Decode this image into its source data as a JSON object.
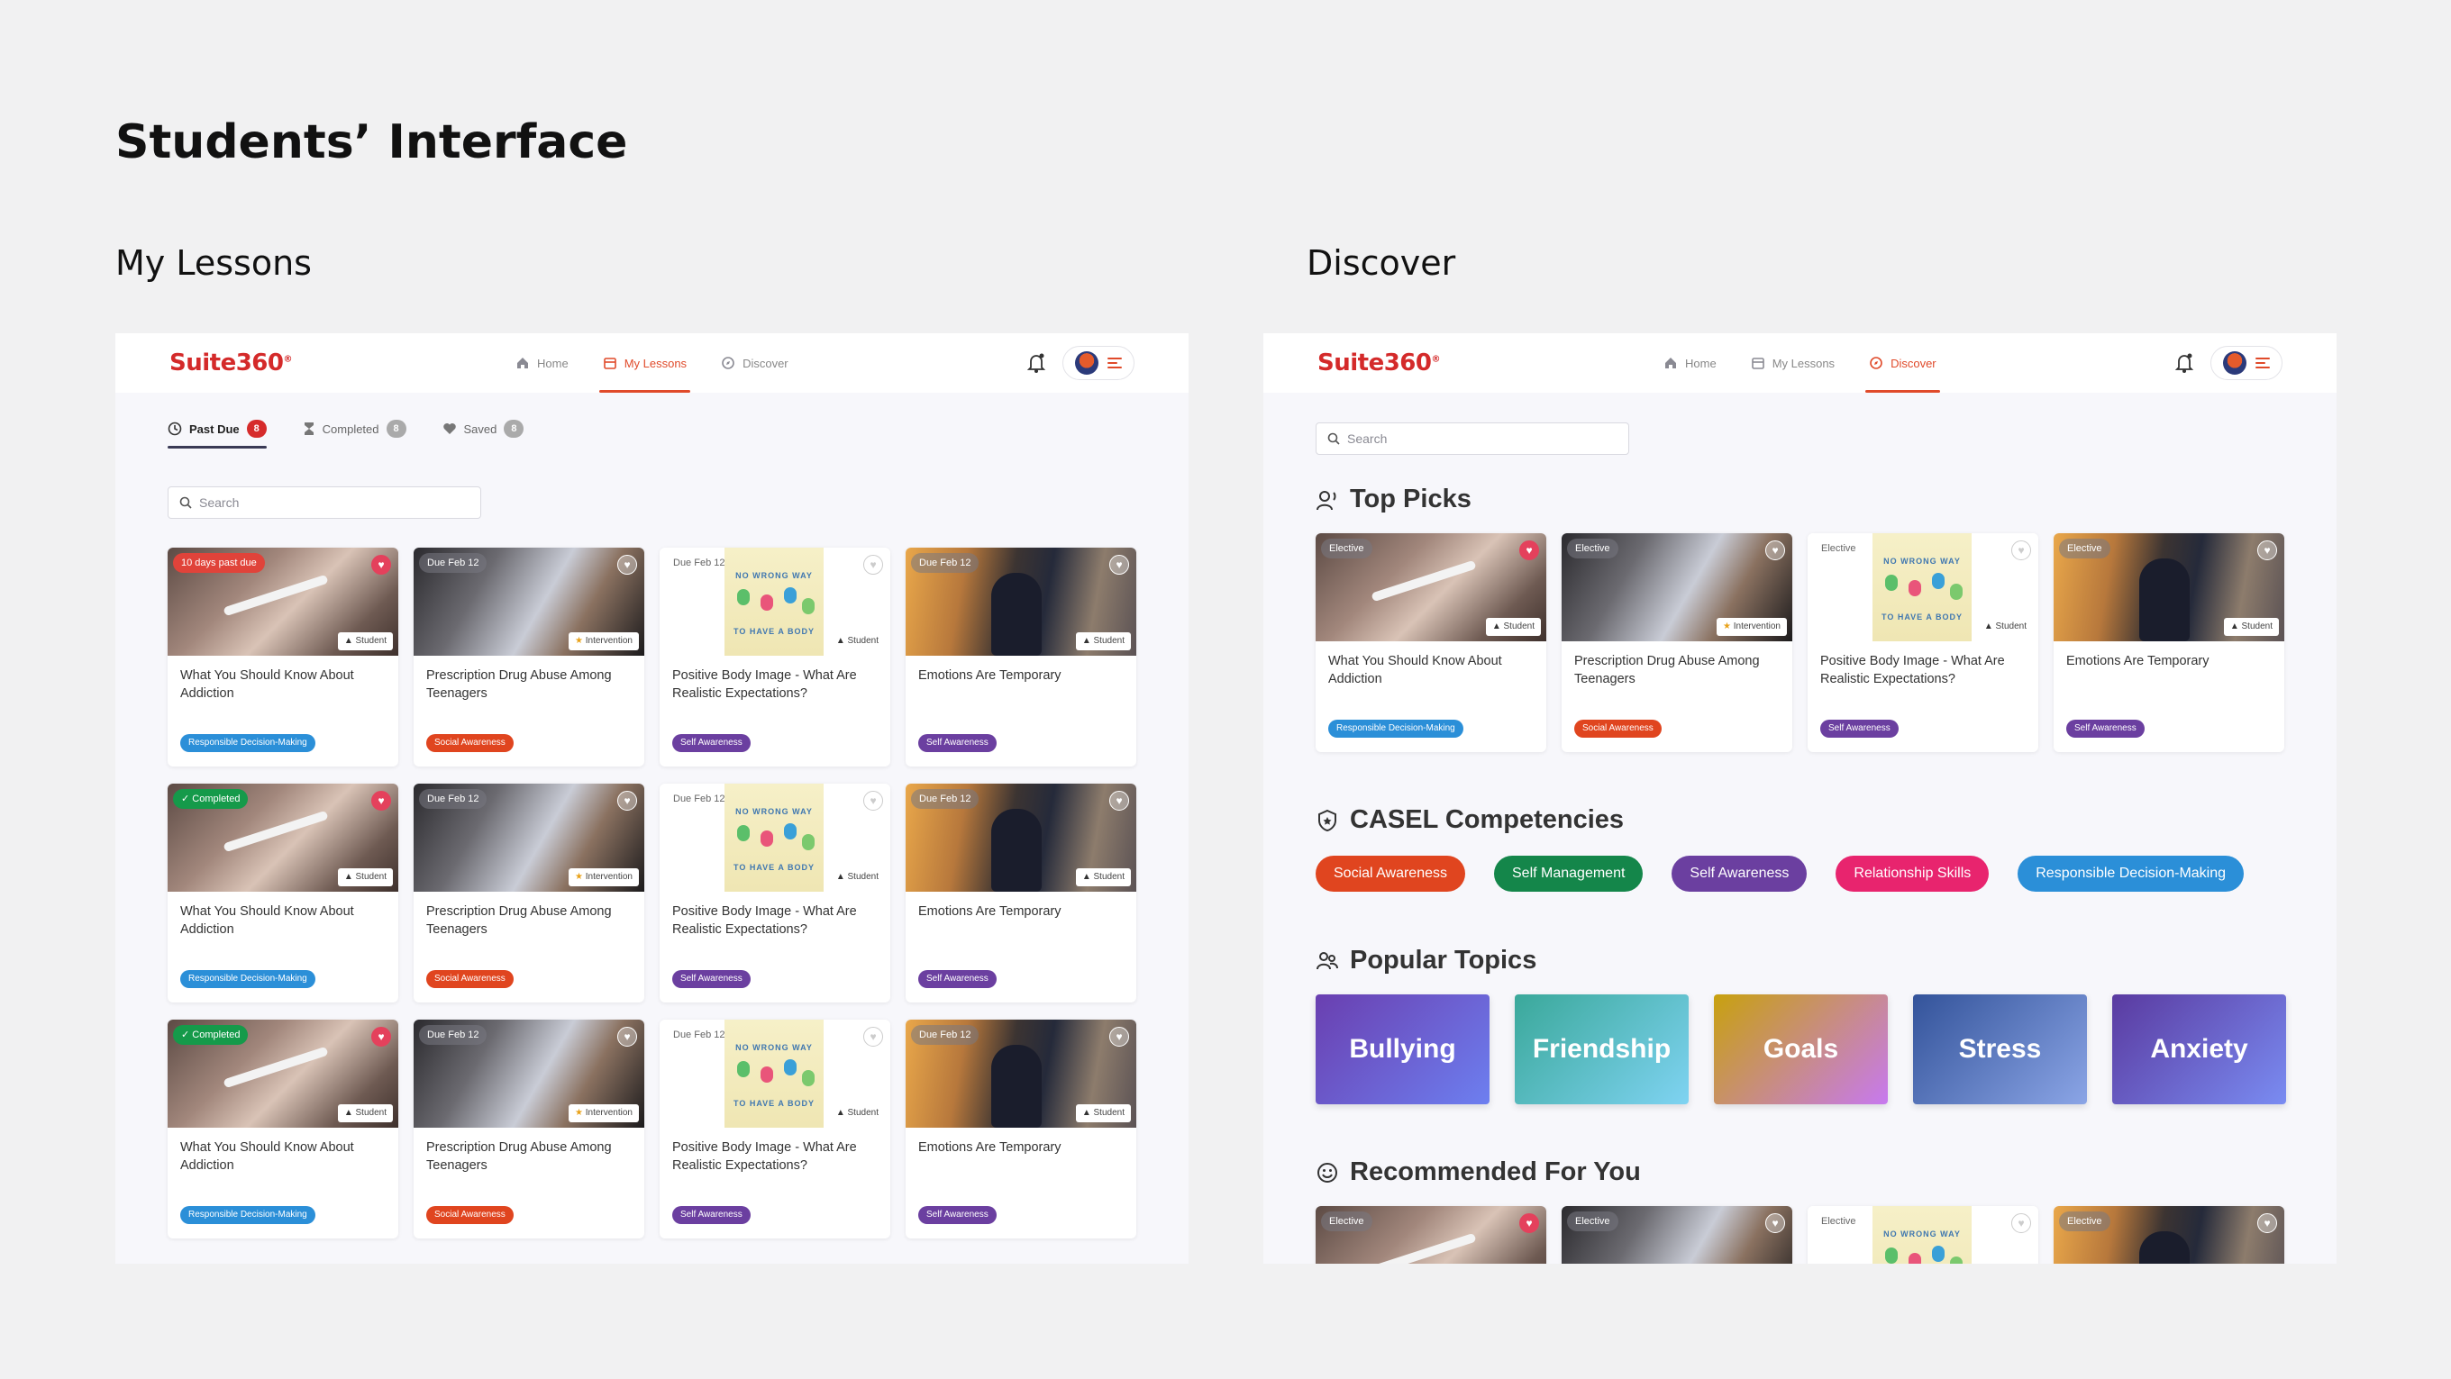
{
  "page_title": "Students’ Interface",
  "sections": {
    "left": "My Lessons",
    "right": "Discover"
  },
  "nav": {
    "logo": "Suite360",
    "home": "Home",
    "my_lessons": "My Lessons",
    "discover": "Discover"
  },
  "tabs": {
    "past_due": "Past Due",
    "past_due_count": "8",
    "completed": "Completed",
    "completed_count": "8",
    "saved": "Saved",
    "saved_count": "8"
  },
  "search": {
    "placeholder": "Search"
  },
  "lessons": [
    [
      {
        "tag": "10 days past due",
        "tag_style": "red",
        "fav": "filled",
        "thumb": "hand",
        "type": "Student",
        "title": "What You Should Know About Addiction",
        "comp": "Responsible Decision-Making",
        "comp_color": "#2b8fd8"
      },
      {
        "tag": "Due Feb 12",
        "tag_style": "grey",
        "fav": "outline",
        "thumb": "pills",
        "type": "Intervention",
        "title": "Prescription Drug Abuse Among Teenagers",
        "comp": "Social Awareness",
        "comp_color": "#e0451f"
      },
      {
        "tag": "Due Feb 12",
        "tag_style": "plain",
        "fav": "grey",
        "thumb": "body",
        "type": "Student",
        "title": "Positive Body Image - What Are Realistic Expectations?",
        "comp": "Self Awareness",
        "comp_color": "#6b3fa0"
      },
      {
        "tag": "Due Feb 12",
        "tag_style": "grey",
        "fav": "outline",
        "thumb": "emo",
        "type": "Student",
        "title": "Emotions Are Temporary",
        "comp": "Self Awareness",
        "comp_color": "#6b3fa0"
      }
    ],
    [
      {
        "tag": "Completed",
        "tag_style": "green",
        "fav": "filled",
        "thumb": "hand",
        "type": "Student",
        "title": "What You Should Know About Addiction",
        "comp": "Responsible Decision-Making",
        "comp_color": "#2b8fd8"
      },
      {
        "tag": "Due Feb 12",
        "tag_style": "grey",
        "fav": "outline",
        "thumb": "pills",
        "type": "Intervention",
        "title": "Prescription Drug Abuse Among Teenagers",
        "comp": "Social Awareness",
        "comp_color": "#e0451f"
      },
      {
        "tag": "Due Feb 12",
        "tag_style": "plain",
        "fav": "grey",
        "thumb": "body",
        "type": "Student",
        "title": "Positive Body Image - What Are Realistic Expectations?",
        "comp": "Self Awareness",
        "comp_color": "#6b3fa0"
      },
      {
        "tag": "Due Feb 12",
        "tag_style": "grey",
        "fav": "outline",
        "thumb": "emo",
        "type": "Student",
        "title": "Emotions Are Temporary",
        "comp": "Self Awareness",
        "comp_color": "#6b3fa0"
      }
    ],
    [
      {
        "tag": "Completed",
        "tag_style": "green",
        "fav": "filled",
        "thumb": "hand",
        "type": "Student",
        "title": "What You Should Know About Addiction",
        "comp": "Responsible Decision-Making",
        "comp_color": "#2b8fd8"
      },
      {
        "tag": "Due Feb 12",
        "tag_style": "grey",
        "fav": "outline",
        "thumb": "pills",
        "type": "Intervention",
        "title": "Prescription Drug Abuse Among Teenagers",
        "comp": "Social Awareness",
        "comp_color": "#e0451f"
      },
      {
        "tag": "Due Feb 12",
        "tag_style": "plain",
        "fav": "grey",
        "thumb": "body",
        "type": "Student",
        "title": "Positive Body Image - What Are Realistic Expectations?",
        "comp": "Self Awareness",
        "comp_color": "#6b3fa0"
      },
      {
        "tag": "Due Feb 12",
        "tag_style": "grey",
        "fav": "outline",
        "thumb": "emo",
        "type": "Student",
        "title": "Emotions Are Temporary",
        "comp": "Self Awareness",
        "comp_color": "#6b3fa0"
      }
    ]
  ],
  "discover": {
    "top_picks_heading": "Top Picks",
    "top_picks": [
      {
        "tag": "Elective",
        "tag_style": "grey",
        "fav": "filled",
        "thumb": "hand",
        "type": "Student",
        "title": "What You Should Know About Addiction",
        "comp": "Responsible Decision-Making",
        "comp_color": "#2b8fd8"
      },
      {
        "tag": "Elective",
        "tag_style": "grey",
        "fav": "outline",
        "thumb": "pills",
        "type": "Intervention",
        "title": "Prescription Drug Abuse Among Teenagers",
        "comp": "Social Awareness",
        "comp_color": "#e0451f"
      },
      {
        "tag": "Elective",
        "tag_style": "plain",
        "fav": "grey",
        "thumb": "body",
        "type": "Student",
        "title": "Positive Body Image - What Are Realistic Expectations?",
        "comp": "Self Awareness",
        "comp_color": "#6b3fa0"
      },
      {
        "tag": "Elective",
        "tag_style": "grey",
        "fav": "outline",
        "thumb": "emo",
        "type": "Student",
        "title": "Emotions Are Temporary",
        "comp": "Self Awareness",
        "comp_color": "#6b3fa0"
      }
    ],
    "casel_heading": "CASEL Competencies",
    "competencies": [
      {
        "label": "Social Awareness",
        "color": "#e0451f"
      },
      {
        "label": "Self Management",
        "color": "#14864a"
      },
      {
        "label": "Self Awareness",
        "color": "#6b3fa0"
      },
      {
        "label": "Relationship Skills",
        "color": "#e8246e"
      },
      {
        "label": "Responsible Decision-Making",
        "color": "#2b8fd8"
      }
    ],
    "popular_heading": "Popular Topics",
    "topics": [
      {
        "label": "Bullying",
        "gradient": [
          "#6a3fb0",
          "#6d7ff0"
        ]
      },
      {
        "label": "Friendship",
        "gradient": [
          "#3aa89a",
          "#7fd3f2"
        ]
      },
      {
        "label": "Goals",
        "gradient": [
          "#c8a10e",
          "#c779f0"
        ]
      },
      {
        "label": "Stress",
        "gradient": [
          "#33539a",
          "#8ba5e6"
        ]
      },
      {
        "label": "Anxiety",
        "gradient": [
          "#5a3aa0",
          "#7a8cf2"
        ]
      }
    ],
    "recommended_heading": "Recommended For You",
    "recommended": [
      {
        "tag": "Elective",
        "tag_style": "grey",
        "fav": "filled",
        "thumb": "hand"
      },
      {
        "tag": "Elective",
        "tag_style": "grey",
        "fav": "outline",
        "thumb": "pills"
      },
      {
        "tag": "Elective",
        "tag_style": "plain",
        "fav": "grey",
        "thumb": "body"
      },
      {
        "tag": "Elective",
        "tag_style": "grey",
        "fav": "outline",
        "thumb": "emo"
      }
    ]
  },
  "poster_text": {
    "top": "NO WRONG WAY",
    "bottom": "TO HAVE A BODY"
  }
}
